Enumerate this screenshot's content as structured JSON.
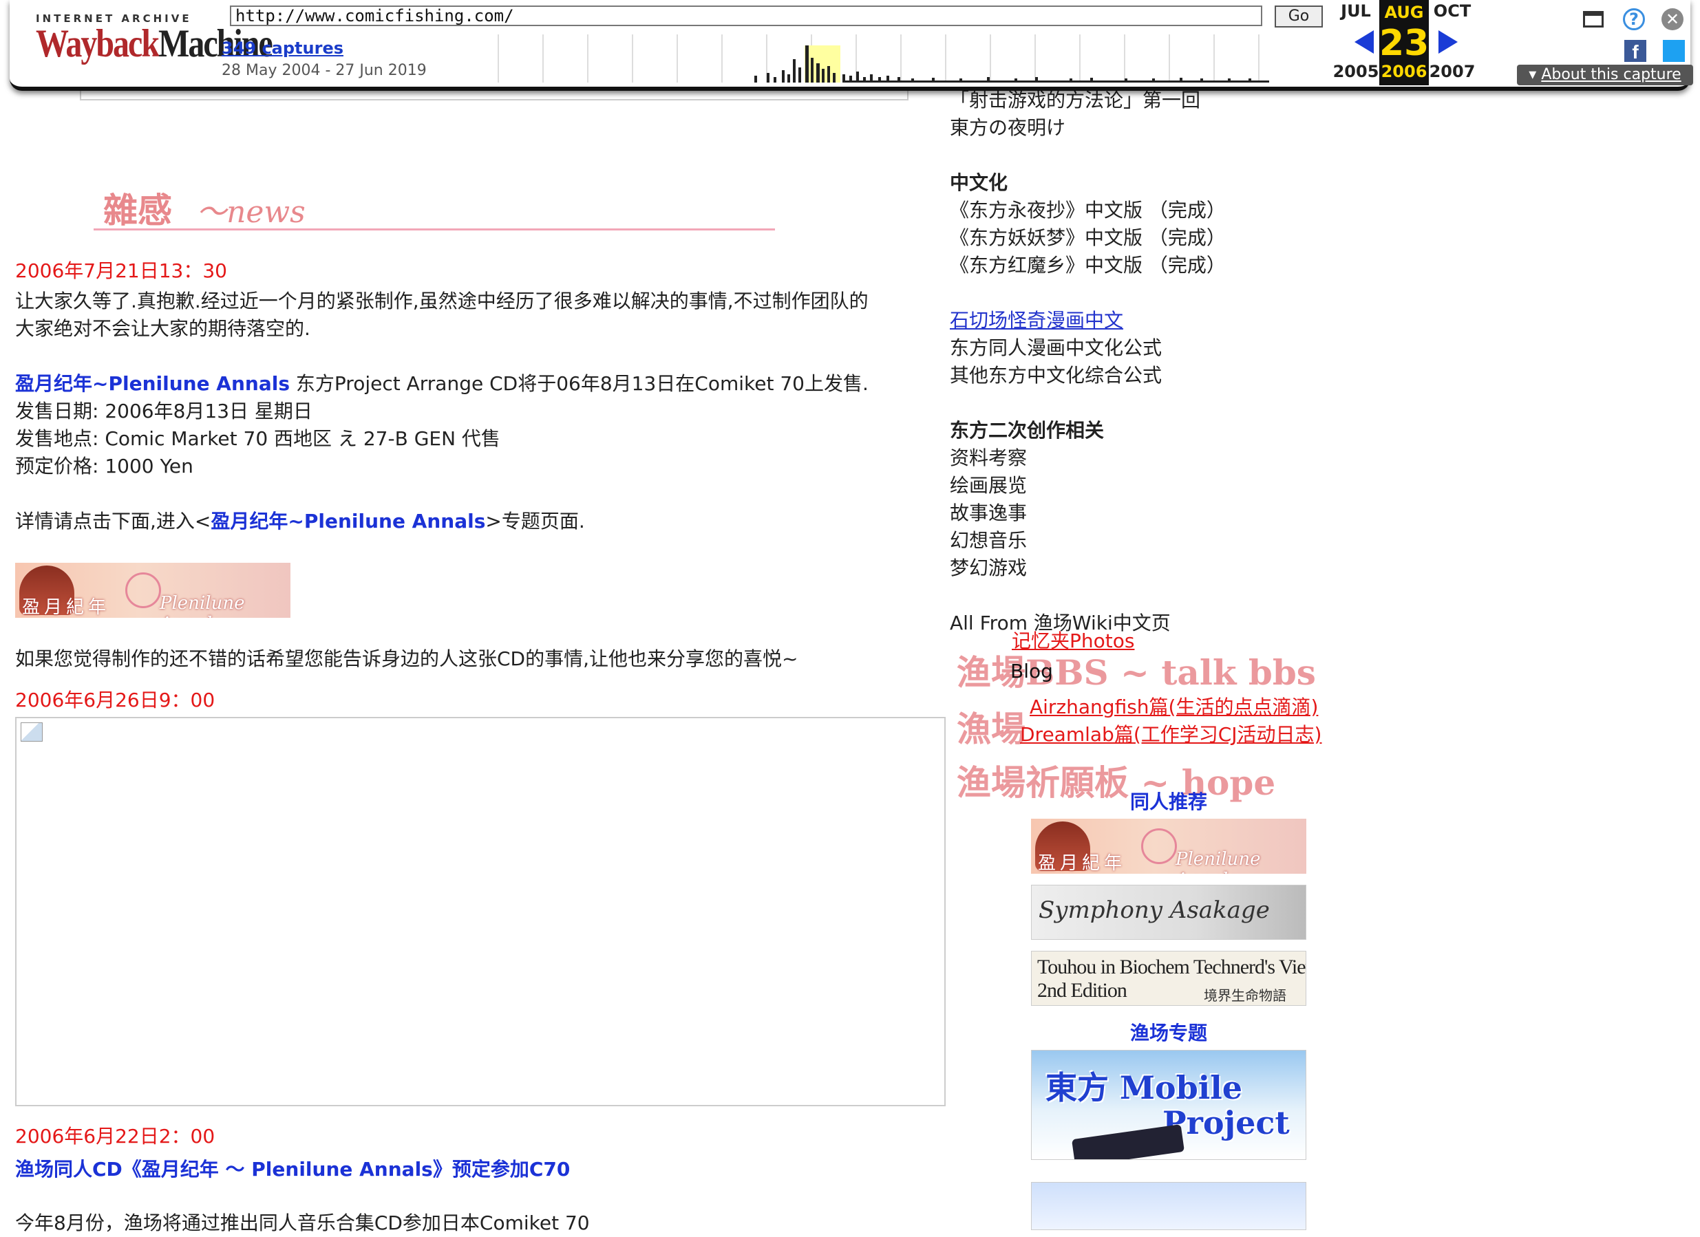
{
  "wayback": {
    "logo_top": "INTERNET ARCHIVE",
    "logo_a": "Wayback",
    "logo_b": "Machine",
    "url": "http://www.comicfishing.com/",
    "go": "Go",
    "captures": "349 captures",
    "range": "28 May 2004 - 27 Jun 2019",
    "months": {
      "prev": "JUL",
      "cur": "AUG",
      "next": "OCT"
    },
    "day": "23",
    "years": {
      "prev": "2005",
      "cur": "2006",
      "next": "2007"
    },
    "about": "About this capture"
  },
  "sidebar": {
    "top_items": [
      "「射击游戏的方法论」第一回",
      "東方の夜明け"
    ],
    "cn_heading": "中文化",
    "cn_items": [
      "《东方永夜抄》中文版 （完成）",
      "《东方妖妖梦》中文版 （完成）",
      "《东方红魔乡》中文版 （完成）"
    ],
    "link1": "石切场怪奇漫画中文",
    "plain1": "东方同人漫画中文化公式",
    "plain2": "其他东方中文化综合公式",
    "derive_heading": "东方二次创作相关",
    "derive_items": [
      "资料考察",
      "绘画展览",
      "故事逸事",
      "幻想音乐",
      "梦幻游戏"
    ],
    "allfrom": "All From 渔场Wiki中文页",
    "photos": "记忆夹Photos",
    "bbs_img": "渔場BBS ~ talk bbs",
    "blog": "Blog",
    "blog1": "Airzhangfish篇(生活的点点滴滴)",
    "blog2": "Dreamlab篇(工作学习CJ活动日志)",
    "hope_img": "渔場祈願板 ~ hope",
    "doujin_heading": "同人推荐",
    "banner_asakage": "Symphony Asakage",
    "banner_touhou1": "Touhou in Biochem Technerd's View,",
    "banner_touhou2": "2nd Edition",
    "banner_touhou3": "境界生命物語",
    "topic_heading": "渔场专题",
    "banner_mobile1": "東方 Mobile",
    "banner_mobile2": "Project"
  },
  "main": {
    "news_heading": "雜感",
    "news_sub": "～news",
    "date1": "2006年7月21日13：30",
    "p1a": "让大家久等了.真抱歉.经过近一个月的紧张制作,虽然途中经历了很多难以解决的事情,不过制作团队的",
    "p1b": "大家绝对不会让大家的期待落空的.",
    "cd_link": "盈月纪年~Plenilune Annals",
    "cd_text": " 东方Project Arrange CD将于06年8月13日在Comiket 70上发售.",
    "sale_date": "发售日期: 2006年8月13日 星期日",
    "sale_place": "发售地点: Comic Market 70 西地区 え 27-B GEN 代售",
    "price": "预定价格: 1000 Yen",
    "detail_pre": "详情请点击下面,进入<",
    "detail_link": "盈月纪年~Plenilune Annals",
    "detail_post": ">专题页面.",
    "banner_left": "盈月紀年",
    "banner_right": "Plenilune Annals",
    "share": "如果您觉得制作的还不错的话希望您能告诉身边的人这张CD的事情,让他也来分享您的喜悦~",
    "date2": "2006年6月26日9：00",
    "date3": "2006年6月22日2：00",
    "headline3": "渔场同人CD《盈月纪年 ～ Plenilune Annals》预定参加C70",
    "cut_text": "今年8月份，渔场将通过推出同人音乐合集CD参加日本Comiket 70"
  },
  "colors": {
    "accent_red": "#e41818",
    "link_blue": "#1b32d6",
    "wayback_yellow": "#ffd800"
  }
}
